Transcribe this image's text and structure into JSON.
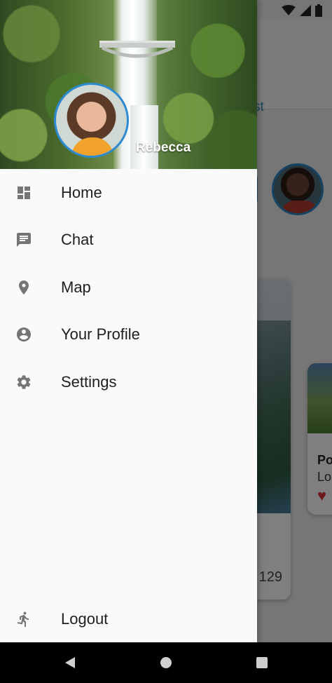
{
  "background_app": {
    "tab_text": "st",
    "card_count": "129",
    "card2_title": "Po",
    "card2_subtitle": "Lo"
  },
  "drawer": {
    "user_name": "Rebecca",
    "items": [
      {
        "label": "Home",
        "icon": "dashboard-icon"
      },
      {
        "label": "Chat",
        "icon": "chat-icon"
      },
      {
        "label": "Map",
        "icon": "location-pin-icon"
      },
      {
        "label": "Your Profile",
        "icon": "account-circle-icon"
      },
      {
        "label": "Settings",
        "icon": "gear-icon"
      }
    ],
    "logout_label": "Logout"
  },
  "colors": {
    "accent": "#2d8ad0",
    "icon_gray": "#757575",
    "heart": "#dd3333"
  },
  "navigation_bar": {
    "buttons": [
      "back-icon",
      "home-icon",
      "recents-icon"
    ]
  }
}
